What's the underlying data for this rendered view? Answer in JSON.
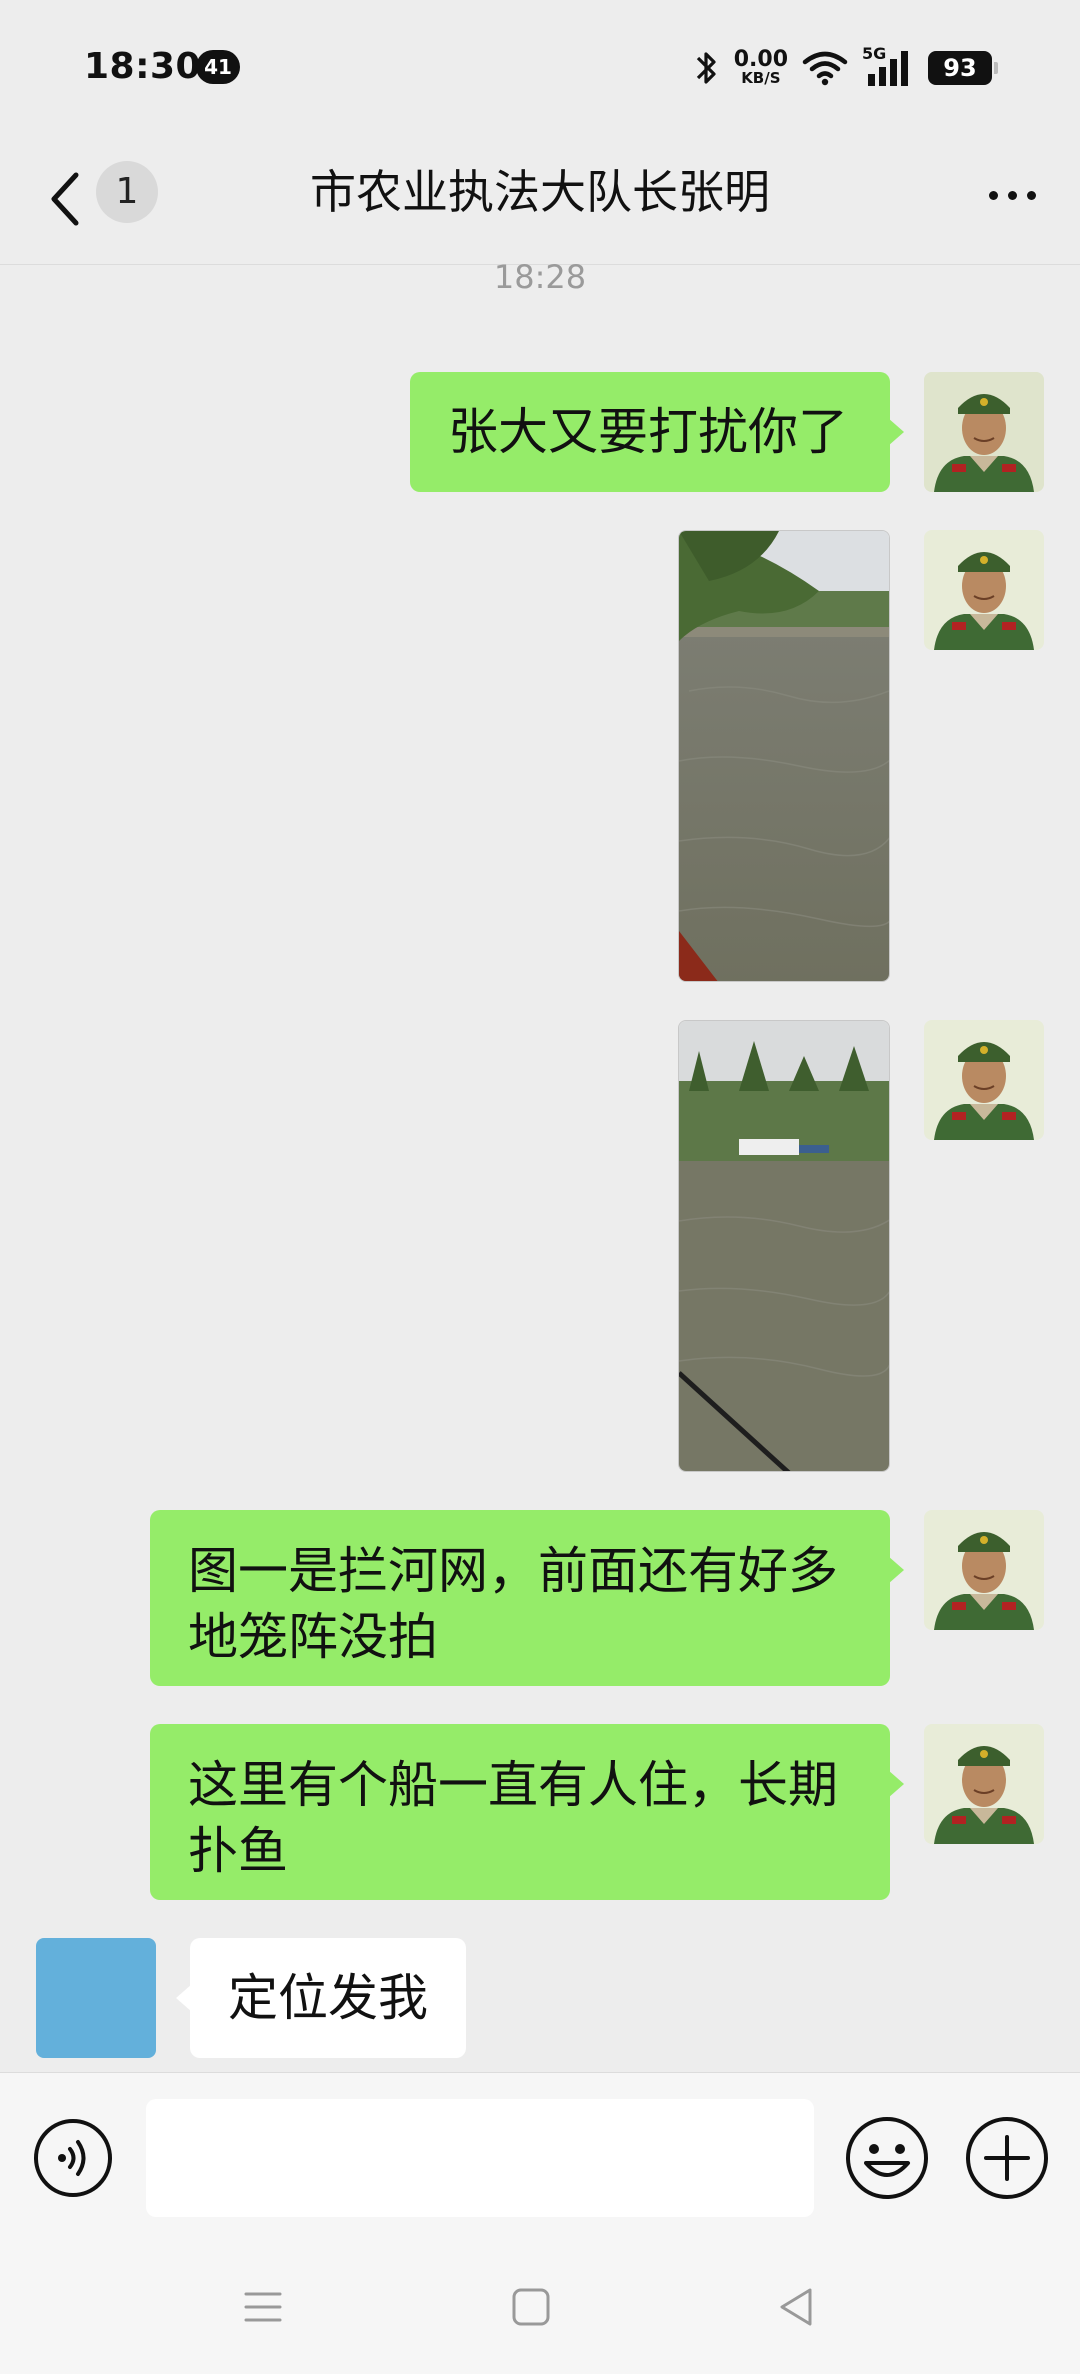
{
  "status_bar": {
    "time": "18:30",
    "notification_count": "41",
    "net_speed_value": "0.00",
    "net_speed_unit": "KB/S",
    "network_type": "5G",
    "battery": "93"
  },
  "header": {
    "back_count": "1",
    "title": "市农业执法大队长张明"
  },
  "conversation": {
    "timestamp": "18:28",
    "messages": [
      {
        "side": "me",
        "type": "text",
        "text": "张大又要打扰你了"
      },
      {
        "side": "me",
        "type": "image",
        "icon": "river-photo-1"
      },
      {
        "side": "me",
        "type": "image",
        "icon": "river-photo-2"
      },
      {
        "side": "me",
        "type": "text",
        "text_line1": "图一是拦河网，前面还有好多",
        "text_line2": "地笼阵没拍"
      },
      {
        "side": "me",
        "type": "text",
        "text_line1": "这里有个船一直有人住，长期",
        "text_line2": "扑鱼"
      },
      {
        "side": "other",
        "type": "text",
        "text": "定位发我"
      }
    ]
  },
  "input_bar": {
    "placeholder": "",
    "value": ""
  },
  "colors": {
    "my_bubble": "#95ec69",
    "other_bubble": "#ffffff",
    "background": "#ededed",
    "other_avatar": "#63b0db"
  }
}
